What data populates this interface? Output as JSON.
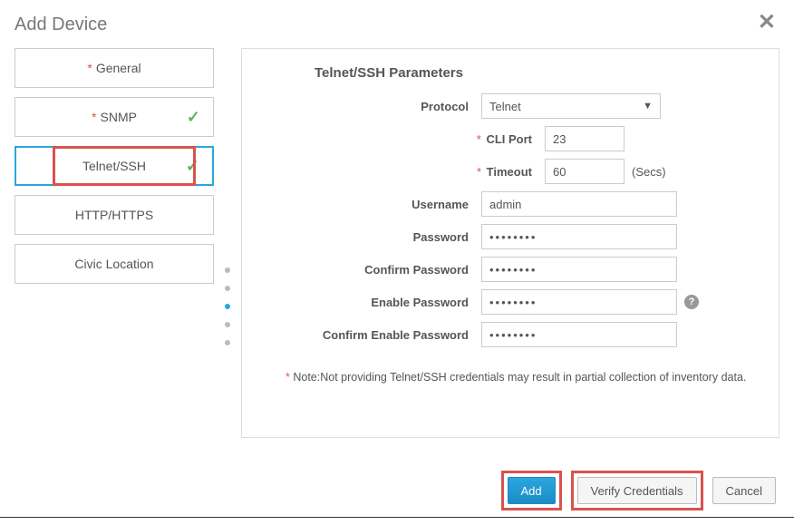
{
  "dialog": {
    "title": "Add Device"
  },
  "sidebar": {
    "steps": [
      {
        "label": "General",
        "required": true,
        "checked": false
      },
      {
        "label": "SNMP",
        "required": true,
        "checked": true
      },
      {
        "label": "Telnet/SSH",
        "required": false,
        "checked": true
      },
      {
        "label": "HTTP/HTTPS",
        "required": false,
        "checked": false
      },
      {
        "label": "Civic Location",
        "required": false,
        "checked": false
      }
    ]
  },
  "panel": {
    "title": "Telnet/SSH Parameters",
    "labels": {
      "protocol": "Protocol",
      "cli_port": "CLI Port",
      "timeout": "Timeout",
      "timeout_suffix": "(Secs)",
      "username": "Username",
      "password": "Password",
      "confirm_password": "Confirm Password",
      "enable_password": "Enable Password",
      "confirm_enable_password": "Confirm Enable Password"
    },
    "values": {
      "protocol": "Telnet",
      "cli_port": "23",
      "timeout": "60",
      "username": "admin",
      "password": "••••••••",
      "confirm_password": "••••••••",
      "enable_password": "••••••••",
      "confirm_enable_password": "••••••••"
    },
    "note_prefix": "*",
    "note": " Note:Not providing Telnet/SSH credentials may result in partial collection of inventory data."
  },
  "footer": {
    "add": "Add",
    "verify": "Verify Credentials",
    "cancel": "Cancel"
  },
  "icons": {
    "check": "✓",
    "close": "✕",
    "help": "?",
    "dropdown": "▼"
  }
}
